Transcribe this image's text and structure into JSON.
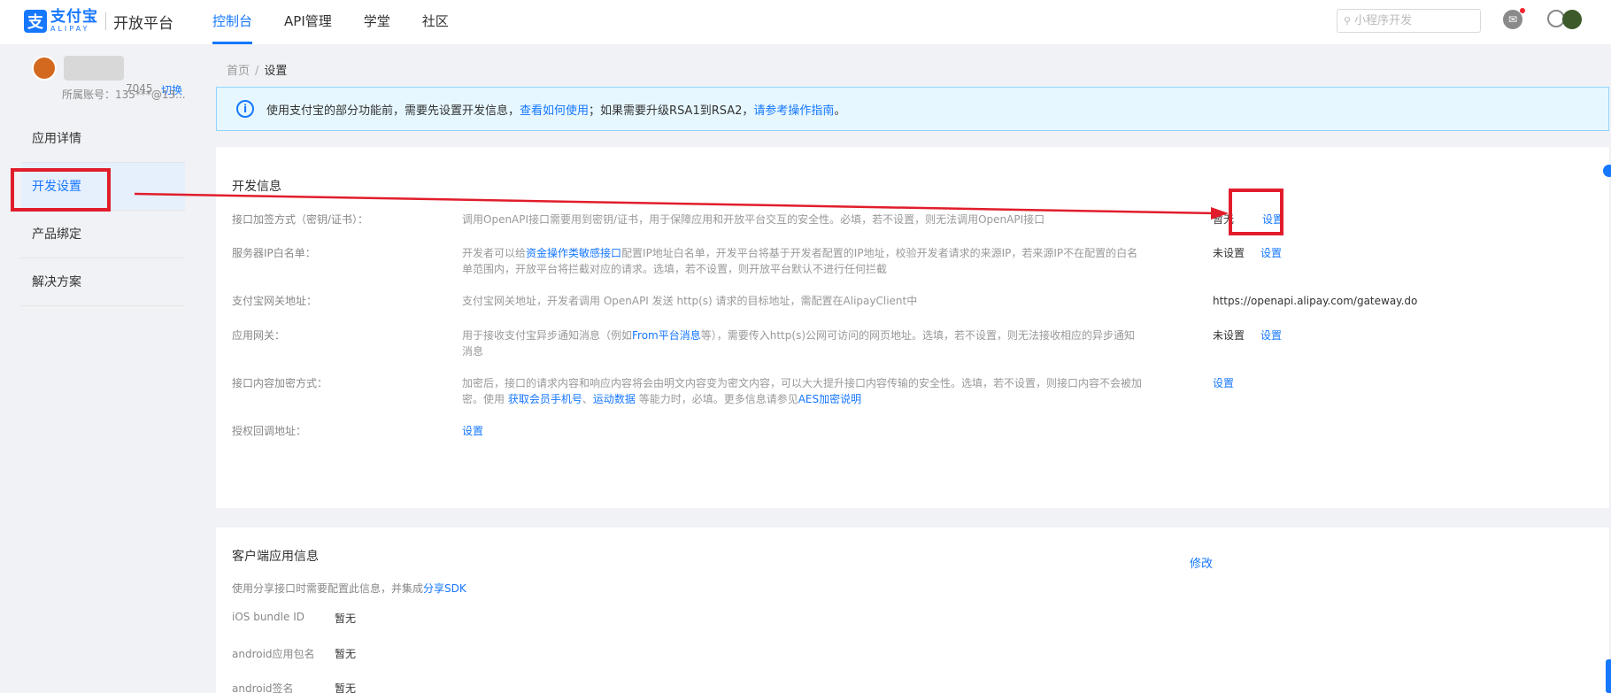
{
  "header": {
    "logo_text": "支付宝",
    "logo_sub": "ALIPAY",
    "platform": "开放平台",
    "nav": [
      {
        "label": "控制台"
      },
      {
        "label": "API管理"
      },
      {
        "label": "学堂"
      },
      {
        "label": "社区"
      }
    ],
    "search_placeholder": "小程序开发"
  },
  "sidebar": {
    "app_id_suffix": "7045",
    "switch_label": "切换",
    "account": "所属账号：135***@13...",
    "menu": [
      {
        "label": "应用详情"
      },
      {
        "label": "开发设置"
      },
      {
        "label": "产品绑定"
      },
      {
        "label": "解决方案"
      }
    ]
  },
  "breadcrumb": {
    "home": "首页",
    "sep": "/",
    "current": "设置"
  },
  "notice": {
    "prefix": "使用支付宝的部分功能前，需要先设置开发信息，",
    "link1": "查看如何使用",
    "middle": "；如果需要升级RSA1到RSA2，",
    "link2": "请参考操作指南",
    "suffix": "。"
  },
  "dev_info": {
    "title": "开发信息",
    "rows": [
      {
        "label": "接口加签方式（密钥/证书）：",
        "desc": "调用OpenAPI接口需要用到密钥/证书，用于保障应用和开放平台交互的安全性。必填，若不设置，则无法调用OpenAPI接口",
        "value": "暂无",
        "action": "设置"
      },
      {
        "label": "服务器IP白名单：",
        "desc_a": "开发者可以给",
        "desc_link": "资金操作类敏感接口",
        "desc_b": "配置IP地址白名单，开发平台将基于开发者配置的IP地址，校验开发者请求的来源IP，若来源IP不在配置的白名单范围内，开放平台将拦截对应的请求。选填，若不设置，则开放平台默认不进行任何拦截",
        "value": "未设置",
        "action": "设置"
      },
      {
        "label": "支付宝网关地址：",
        "desc": "支付宝网关地址，开发者调用 OpenAPI 发送 http(s) 请求的目标地址，需配置在AlipayClient中",
        "value": "https://openapi.alipay.com/gateway.do"
      },
      {
        "label": "应用网关：",
        "desc_a": "用于接收支付宝异步通知消息（例如",
        "desc_link": "From平台消息",
        "desc_b": "等），需要传入http(s)公网可访问的网页地址。选填，若不设置，则无法接收相应的异步通知消息",
        "value": "未设置",
        "action": "设置"
      },
      {
        "label": "接口内容加密方式：",
        "desc_a": "加密后，接口的请求内容和响应内容将会由明文内容变为密文内容，可以大大提升接口内容传输的安全性。选填，若不设置，则接口内容不会被加密。使用 ",
        "desc_link1": "获取会员手机号",
        "desc_mid": "、",
        "desc_link2": "运动数据",
        "desc_b": " 等能力时，必填。更多信息请参见",
        "desc_link3": "AES加密说明",
        "action": "设置"
      },
      {
        "label": "授权回调地址：",
        "action": "设置"
      }
    ]
  },
  "client_info": {
    "title": "客户端应用信息",
    "edit": "修改",
    "note": "使用分享接口时需要配置此信息，并集成",
    "note_link": "分享SDK",
    "rows": [
      {
        "label": "iOS bundle ID",
        "value": "暂无"
      },
      {
        "label": "android应用包名",
        "value": "暂无"
      },
      {
        "label": "android签名",
        "value": "暂无"
      }
    ]
  },
  "colors": {
    "brand": "#1677ff",
    "highlight": "#e11d2b"
  }
}
